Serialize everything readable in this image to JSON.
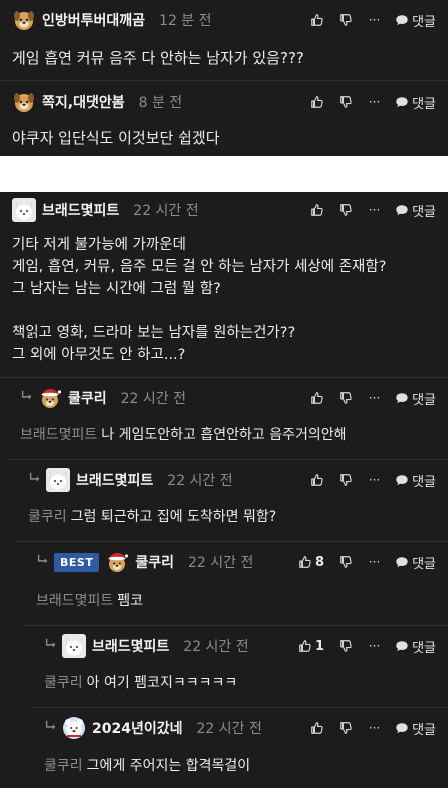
{
  "ui": {
    "reply_label": "댓글",
    "more_glyph": "···",
    "best_label": "BEST",
    "colors": {
      "background": "#1c1c1d",
      "text": "#ececec",
      "muted": "#8c8c8e",
      "best": "#2f5aa8"
    }
  },
  "comments": [
    {
      "nickname": "인방버투버대깨곰",
      "time": "12 분 전",
      "text": "게임 흡연 커뮤 음주 다 안하는 남자가 있음???",
      "avatar": "dog-avatar"
    },
    {
      "nickname": "쪽지,대댓안봄",
      "time": "8 분 전",
      "text": "야쿠자 입단식도 이것보단 쉽겠다",
      "avatar": "dog-avatar"
    },
    {
      "nickname": "브래드몇피트",
      "time": "22 시간 전",
      "text": "기타 저게 불가능에 가까운데\n게임, 흡연, 커뮤, 음주 모든 걸 안 하는 남자가 세상에 존재함?\n그 남자는 남는 시간에 그럼 뭘 함?\n\n책읽고 영화, 드라마 보는 남자를 원하는건가??\n그 외에 아무것도 안 하고...?",
      "avatar": "white-dog-avatar"
    },
    {
      "nickname": "쿨쿠리",
      "time": "22 시간 전",
      "mention": "브래드몇피트",
      "text": "나 게임도안하고 흡연안하고 음주거의안해",
      "avatar": "santa-dog-avatar"
    },
    {
      "nickname": "브래드몇피트",
      "time": "22 시간 전",
      "mention": "쿨쿠리",
      "text": "그럼 퇴근하고 집에 도착하면 뭐함?",
      "avatar": "white-dog-avatar"
    },
    {
      "nickname": "쿨쿠리",
      "time": "22 시간 전",
      "mention": "브래드몇피트",
      "text": "펨코",
      "likes": "8",
      "best": true,
      "avatar": "santa-dog-avatar"
    },
    {
      "nickname": "브래드몇피트",
      "time": "22 시간 전",
      "mention": "쿨쿠리",
      "text": "아 여기 펨코지ㅋㅋㅋㅋㅋ",
      "likes": "1",
      "avatar": "white-dog-avatar"
    },
    {
      "nickname": "2024년이갔네",
      "time": "22 시간 전",
      "mention": "쿨쿠리",
      "text": "그에게 주어지는 합격목걸이",
      "avatar": "bear-avatar"
    }
  ]
}
